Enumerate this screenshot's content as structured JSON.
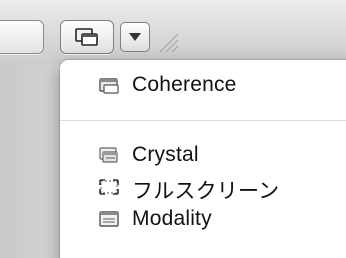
{
  "toolbar": {
    "prev_icon": "chevron-left-icon",
    "view_icon": "coherence-window-icon",
    "dropdown_icon": "triangle-down-icon",
    "grip_icon": "resize-grip-icon"
  },
  "menu": {
    "items": [
      {
        "label": "Coherence",
        "icon": "coherence-icon"
      },
      {
        "label": "Crystal",
        "icon": "crystal-icon"
      },
      {
        "label": "フルスクリーン",
        "icon": "fullscreen-icon"
      },
      {
        "label": "Modality",
        "icon": "modality-icon"
      }
    ]
  },
  "colors": {
    "menu_background": "#ffffff",
    "toolbar_background": "#d9d9d9",
    "text": "#111111",
    "separator": "#dedede"
  }
}
